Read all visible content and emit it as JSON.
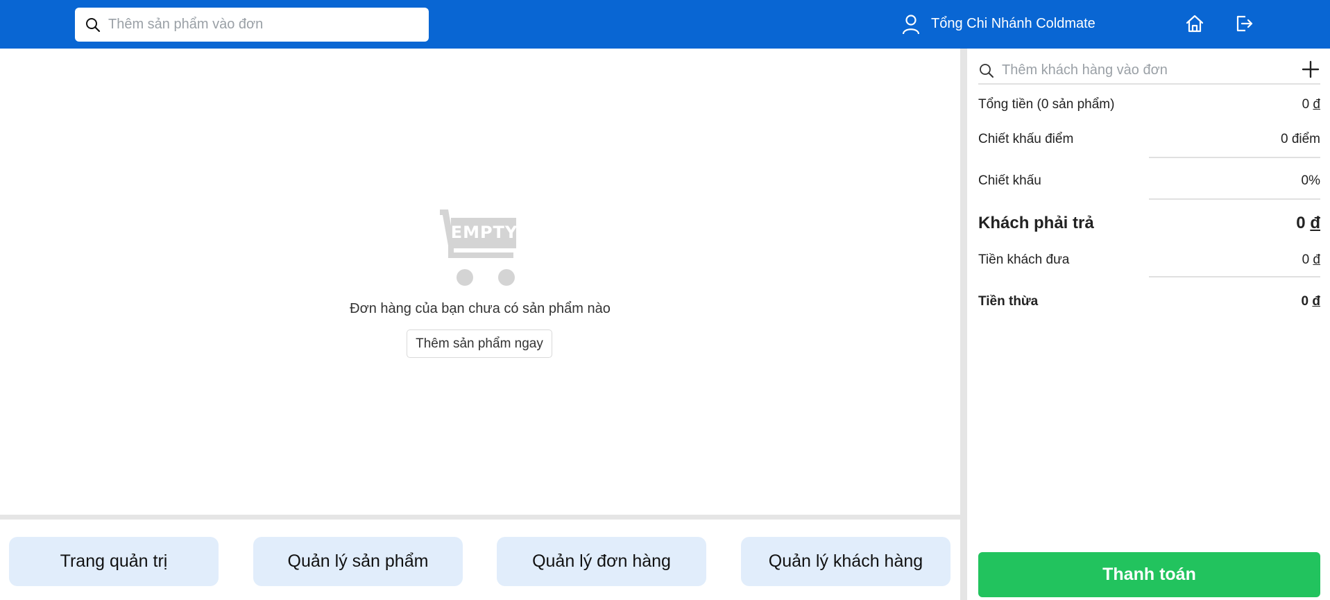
{
  "header": {
    "product_search_placeholder": "Thêm sản phẩm vào đơn",
    "branch_name": "Tổng Chi Nhánh Coldmate",
    "icons": [
      "search-icon",
      "user-icon",
      "home-icon",
      "logout-icon"
    ],
    "background_color": "#0966d3"
  },
  "cart": {
    "empty_image_text": "EMPTY",
    "empty_message": "Đơn hàng của bạn chưa có sản phẩm nào",
    "add_now_label": "Thêm sản phẩm ngay"
  },
  "nav": {
    "items": [
      {
        "label": "Trang quản trị"
      },
      {
        "label": "Quản lý sản phẩm"
      },
      {
        "label": "Quản lý đơn hàng"
      },
      {
        "label": "Quản lý khách hàng"
      }
    ],
    "button_color": "#e1edfb"
  },
  "summary": {
    "customer_search_placeholder": "Thêm khách hàng vào đơn",
    "total_label": "Tổng tiền (0 sản phẩm)",
    "total_value": "0",
    "points_discount_label": "Chiết khấu điểm",
    "points_discount_value": "0 điểm",
    "discount_label": "Chiết khấu",
    "discount_value": "0%",
    "customer_pays_label": "Khách phải trả",
    "customer_pays_value": "0",
    "customer_gives_label": "Tiền khách đưa",
    "customer_gives_value": "0",
    "change_label": "Tiền thừa",
    "change_value": "0",
    "currency": "đ"
  },
  "payment": {
    "pay_label": "Thanh toán",
    "color": "#22c35e"
  }
}
